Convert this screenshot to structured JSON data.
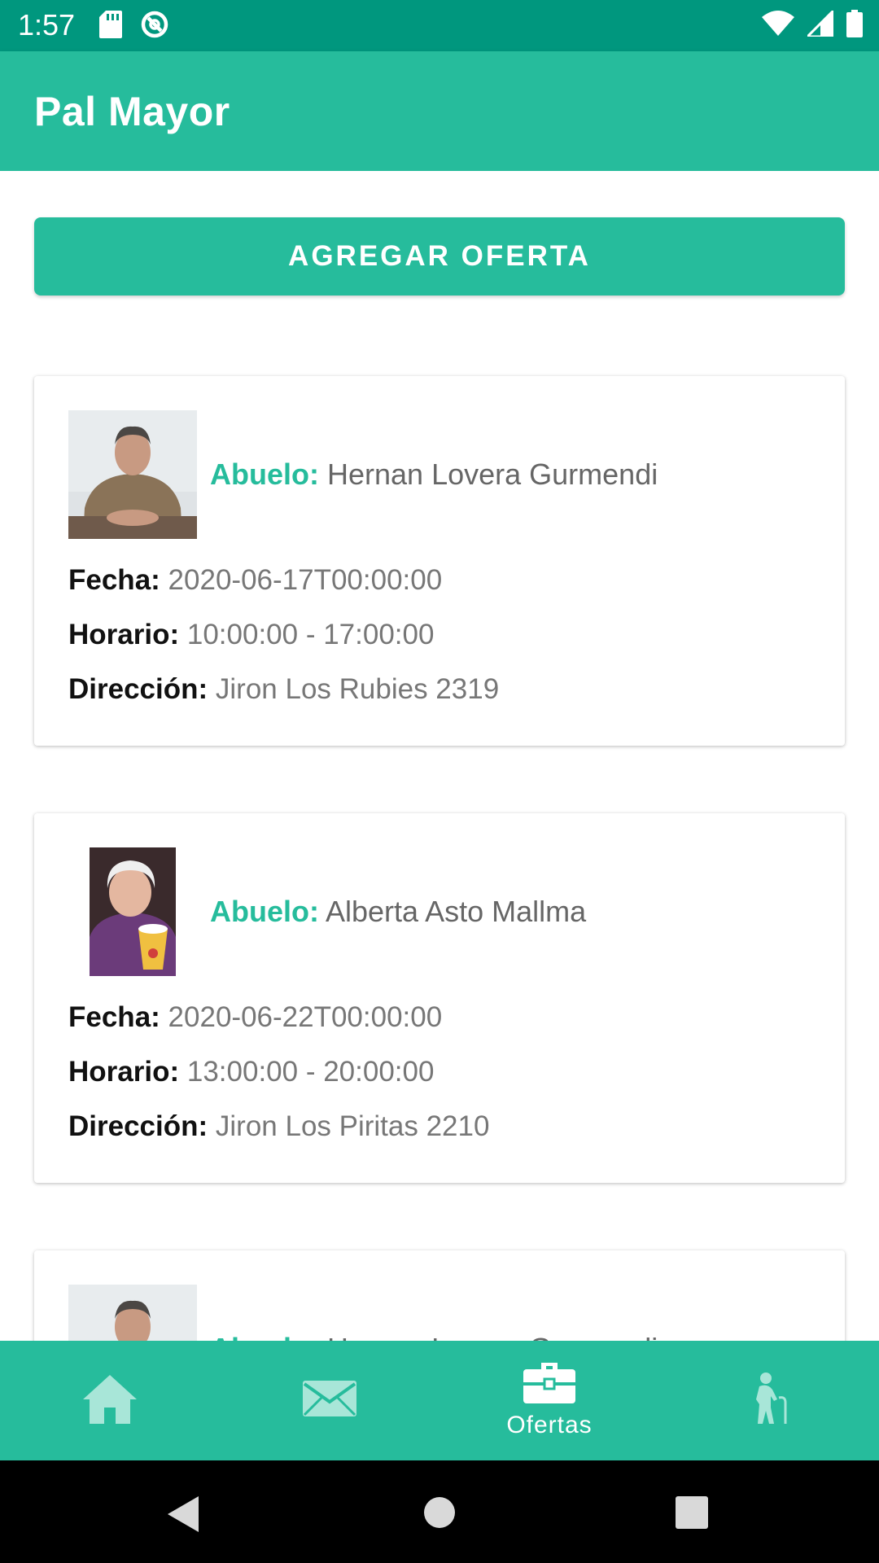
{
  "status_bar": {
    "time": "1:57"
  },
  "app_bar": {
    "title": "Pal Mayor"
  },
  "actions": {
    "add_offer_label": "AGREGAR OFERTA"
  },
  "labels": {
    "abuelo": "Abuelo:",
    "fecha": "Fecha:",
    "horario": "Horario:",
    "direccion": "Dirección:"
  },
  "offers": [
    {
      "name": "Hernan Lovera Gurmendi",
      "fecha": "2020-06-17T00:00:00",
      "horario": "10:00:00 - 17:00:00",
      "direccion": "Jiron Los Rubies 2319"
    },
    {
      "name": "Alberta Asto Mallma",
      "fecha": "2020-06-22T00:00:00",
      "horario": "13:00:00 - 20:00:00",
      "direccion": "Jiron Los Piritas 2210"
    },
    {
      "name": "Hernan Lovera Gurmendi"
    }
  ],
  "bottom_nav": {
    "items": [
      {
        "icon": "home-icon"
      },
      {
        "icon": "mail-icon"
      },
      {
        "icon": "briefcase-icon",
        "label": "Ofertas"
      },
      {
        "icon": "elderly-icon"
      }
    ]
  },
  "colors": {
    "primary": "#26bc9c",
    "status_bar": "#00977e",
    "nav_inactive_icon": "#a8e6d8"
  }
}
